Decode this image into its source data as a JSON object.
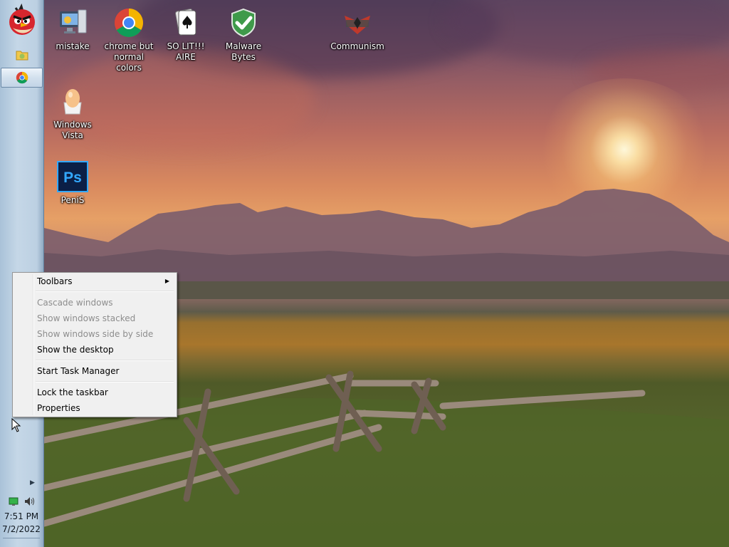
{
  "desktop": {
    "icons": [
      {
        "label": "mistake",
        "icon": "computer-icon"
      },
      {
        "label": "chrome but normal colors",
        "icon": "chrome-icon"
      },
      {
        "label": "SO LIT!!! AIRE",
        "icon": "solitaire-icon"
      },
      {
        "label": "Malware Bytes",
        "icon": "shield-check-icon"
      },
      {
        "label": "Communism",
        "icon": "emblem-icon"
      },
      {
        "label": "Windows Vista",
        "icon": "egg-icon"
      },
      {
        "label": "PeniS",
        "icon": "photoshop-icon",
        "badge": "Ps"
      }
    ]
  },
  "taskbar": {
    "start_icon": "angry-bird-icon",
    "pinned": [
      {
        "icon": "folder-icon"
      },
      {
        "icon": "chrome-icon",
        "active": true
      }
    ],
    "tray": {
      "overflow_icon": "chevron-right-icon",
      "icons": [
        "network-icon",
        "speaker-icon"
      ]
    },
    "clock": {
      "time": "7:51 PM",
      "date": "7/2/2022"
    }
  },
  "context_menu": {
    "items": [
      {
        "label": "Toolbars",
        "enabled": true,
        "submenu": true
      },
      {
        "separator": true
      },
      {
        "label": "Cascade windows",
        "enabled": false
      },
      {
        "label": "Show windows stacked",
        "enabled": false
      },
      {
        "label": "Show windows side by side",
        "enabled": false
      },
      {
        "label": "Show the desktop",
        "enabled": true
      },
      {
        "separator": true
      },
      {
        "label": "Start Task Manager",
        "enabled": true
      },
      {
        "separator": true
      },
      {
        "label": "Lock the taskbar",
        "enabled": true
      },
      {
        "label": "Properties",
        "enabled": true
      }
    ]
  },
  "colors": {
    "taskbar": "#bcd0e2",
    "menu_bg": "#f0f0f0",
    "disabled_text": "#8d8d8d",
    "chrome_red": "#db4437",
    "chrome_green": "#0f9d58",
    "chrome_yellow": "#f4b400",
    "chrome_blue": "#4285f4",
    "photoshop_bg": "#0b1f46",
    "photoshop_text": "#33a8ff"
  }
}
